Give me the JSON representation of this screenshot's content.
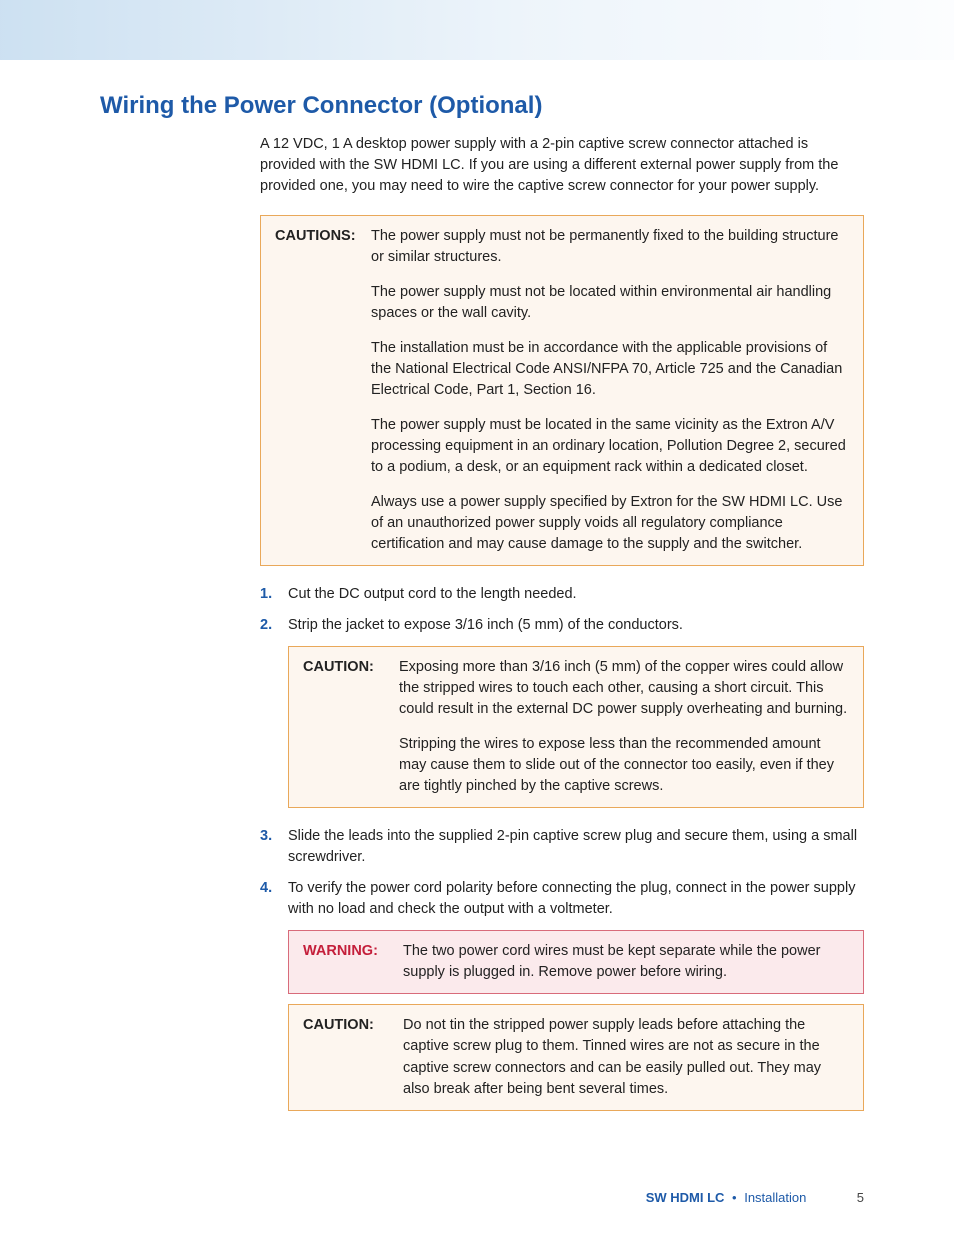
{
  "title": "Wiring the Power Connector (Optional)",
  "intro": "A 12 VDC, 1 A desktop power supply with a 2-pin captive screw connector attached is provided with the SW HDMI LC. If you are using a different external power supply from the provided one, you may need to wire the captive screw connector for your power supply.",
  "cautions1": {
    "label": "CAUTIONS:",
    "items": [
      "The power supply must not be permanently fixed to the building structure or similar structures.",
      "The power supply must not be located within environmental air handling spaces or the wall cavity.",
      "The installation must be in accordance with the applicable provisions of the National  Electrical Code ANSI/NFPA 70, Article 725 and the Canadian Electrical Code, Part 1, Section 16.",
      "The power supply must be located in the same vicinity as the Extron A/V processing equipment in an ordinary location, Pollution Degree 2, secured to a podium, a desk, or an equipment rack within a dedicated closet.",
      "Always use a power supply specified by Extron for the SW HDMI LC. Use of an unauthorized power supply voids all regulatory compliance certification and may cause damage to the supply and the switcher."
    ]
  },
  "steps": {
    "s1": {
      "num": "1.",
      "text": "Cut the DC output cord to the length needed."
    },
    "s2": {
      "num": "2.",
      "text": "Strip the jacket to expose 3/16 inch (5 mm) of the conductors."
    },
    "s3": {
      "num": "3.",
      "text": "Slide the leads into the supplied 2-pin captive screw plug and secure them, using a small screwdriver."
    },
    "s4": {
      "num": "4.",
      "text": "To verify the power cord polarity before connecting the plug, connect in the power supply with no load and check the output with a voltmeter."
    }
  },
  "caution2": {
    "label": "CAUTION:",
    "items": [
      "Exposing more than 3/16 inch (5 mm) of the copper wires could allow the stripped wires to touch each other, causing a short circuit. This could result in the external DC power supply overheating and burning.",
      "Stripping the wires to expose less than the recommended amount may cause them to slide out of the connector too easily, even if they are tightly pinched by the captive screws."
    ]
  },
  "warning": {
    "label": "WARNING:",
    "text": "The two power cord wires must be kept separate while the power supply is plugged in. Remove power before wiring."
  },
  "caution3": {
    "label": "CAUTION:",
    "text": "Do not tin the stripped power supply leads before attaching the captive screw plug to them. Tinned wires are not as secure in the captive screw connectors and can be easily pulled out. They may also break after being bent several times."
  },
  "footer": {
    "product": "SW HDMI LC",
    "section": "Installation",
    "page": "5"
  }
}
